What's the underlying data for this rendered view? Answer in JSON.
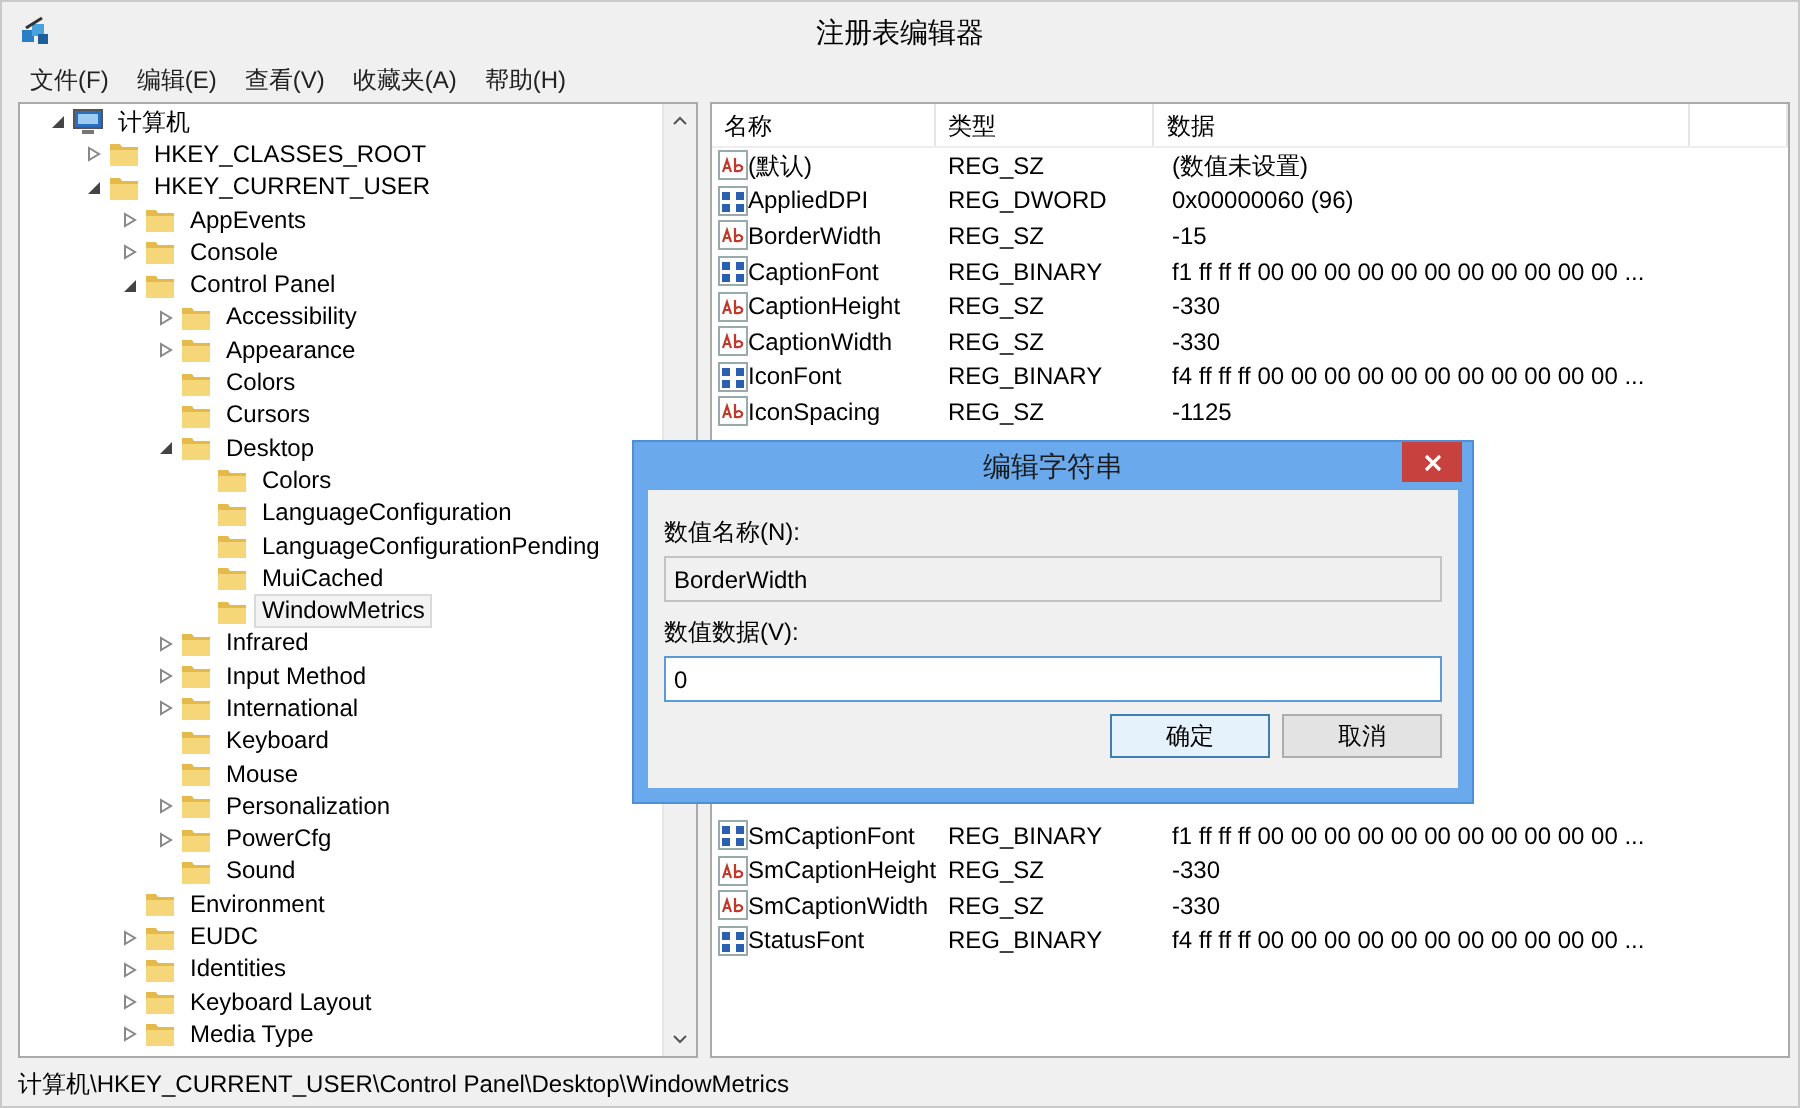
{
  "window": {
    "title": "注册表编辑器"
  },
  "menu": [
    "文件(F)",
    "编辑(E)",
    "查看(V)",
    "收藏夹(A)",
    "帮助(H)"
  ],
  "tree": {
    "label": "计算机",
    "expanded": true,
    "selected": false,
    "children": [
      {
        "label": "HKEY_CLASSES_ROOT",
        "expanded": false,
        "selected": false
      },
      {
        "label": "HKEY_CURRENT_USER",
        "expanded": true,
        "selected": false,
        "children": [
          {
            "label": "AppEvents",
            "expanded": false,
            "selected": false
          },
          {
            "label": "Console",
            "expanded": false,
            "selected": false
          },
          {
            "label": "Control Panel",
            "expanded": true,
            "selected": false,
            "children": [
              {
                "label": "Accessibility",
                "expanded": false,
                "selected": false
              },
              {
                "label": "Appearance",
                "expanded": false,
                "selected": false
              },
              {
                "label": "Colors",
                "selected": false
              },
              {
                "label": "Cursors",
                "selected": false
              },
              {
                "label": "Desktop",
                "expanded": true,
                "selected": false,
                "children": [
                  {
                    "label": "Colors",
                    "selected": false
                  },
                  {
                    "label": "LanguageConfiguration",
                    "selected": false
                  },
                  {
                    "label": "LanguageConfigurationPending",
                    "selected": false
                  },
                  {
                    "label": "MuiCached",
                    "selected": false
                  },
                  {
                    "label": "WindowMetrics",
                    "selected": true
                  }
                ]
              },
              {
                "label": "Infrared",
                "expanded": false,
                "selected": false
              },
              {
                "label": "Input Method",
                "expanded": false,
                "selected": false
              },
              {
                "label": "International",
                "expanded": false,
                "selected": false
              },
              {
                "label": "Keyboard",
                "selected": false
              },
              {
                "label": "Mouse",
                "selected": false
              },
              {
                "label": "Personalization",
                "expanded": false,
                "selected": false
              },
              {
                "label": "PowerCfg",
                "expanded": false,
                "selected": false
              },
              {
                "label": "Sound",
                "selected": false
              }
            ]
          },
          {
            "label": "Environment",
            "selected": false
          },
          {
            "label": "EUDC",
            "expanded": false,
            "selected": false
          },
          {
            "label": "Identities",
            "expanded": false,
            "selected": false
          },
          {
            "label": "Keyboard Layout",
            "expanded": false,
            "selected": false
          },
          {
            "label": "Media Type",
            "expanded": false,
            "selected": false
          }
        ]
      }
    ]
  },
  "list": {
    "columns": [
      "名称",
      "类型",
      "数据"
    ],
    "rows": [
      {
        "kind": "string",
        "name": "(默认)",
        "type": "REG_SZ",
        "data": "(数值未设置)"
      },
      {
        "kind": "binary",
        "name": "AppliedDPI",
        "type": "REG_DWORD",
        "data": "0x00000060 (96)"
      },
      {
        "kind": "string",
        "name": "BorderWidth",
        "type": "REG_SZ",
        "data": "-15"
      },
      {
        "kind": "binary",
        "name": "CaptionFont",
        "type": "REG_BINARY",
        "data": "f1 ff ff ff 00 00 00 00 00 00 00 00 00 00 00 ..."
      },
      {
        "kind": "string",
        "name": "CaptionHeight",
        "type": "REG_SZ",
        "data": "-330"
      },
      {
        "kind": "string",
        "name": "CaptionWidth",
        "type": "REG_SZ",
        "data": "-330"
      },
      {
        "kind": "binary",
        "name": "IconFont",
        "type": "REG_BINARY",
        "data": "f4 ff ff ff 00 00 00 00 00 00 00 00 00 00 00 ..."
      },
      {
        "kind": "string",
        "name": "IconSpacing",
        "type": "REG_SZ",
        "data": "-1125"
      }
    ],
    "rows_below_dialog": [
      {
        "kind": "binary",
        "name": "SmCaptionFont",
        "type": "REG_BINARY",
        "data": "f1 ff ff ff 00 00 00 00 00 00 00 00 00 00 00 ..."
      },
      {
        "kind": "string",
        "name": "SmCaptionHeight",
        "type": "REG_SZ",
        "data": "-330"
      },
      {
        "kind": "string",
        "name": "SmCaptionWidth",
        "type": "REG_SZ",
        "data": "-330"
      },
      {
        "kind": "binary",
        "name": "StatusFont",
        "type": "REG_BINARY",
        "data": "f4 ff ff ff 00 00 00 00 00 00 00 00 00 00 00 ..."
      }
    ]
  },
  "status_bar": "计算机\\HKEY_CURRENT_USER\\Control Panel\\Desktop\\WindowMetrics",
  "dialog": {
    "title": "编辑字符串",
    "name_label": "数值名称(N):",
    "name_value": "BorderWidth",
    "data_label": "数值数据(V):",
    "data_value": "0",
    "buttons": [
      {
        "label": "确定",
        "default": true
      },
      {
        "label": "取消",
        "default": false
      }
    ]
  }
}
